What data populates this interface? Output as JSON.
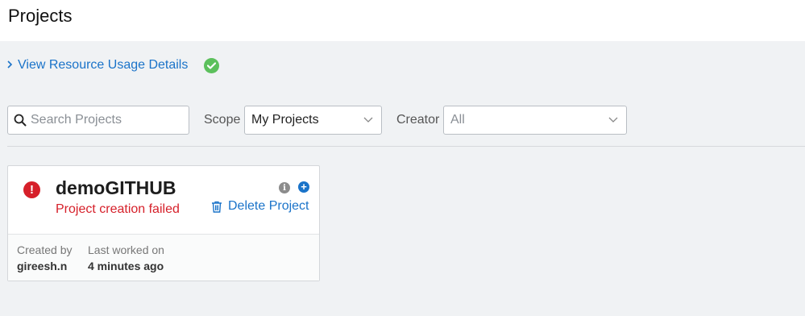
{
  "header": {
    "title": "Projects"
  },
  "resource": {
    "link_label": "View Resource Usage Details",
    "status_icon": "check-circle-icon",
    "status_color": "#5cc05c"
  },
  "filters": {
    "search_placeholder": "Search Projects",
    "search_value": "",
    "scope_label": "Scope",
    "scope_value": "My Projects",
    "creator_label": "Creator",
    "creator_value": "All"
  },
  "projects": [
    {
      "name": "demoGITHUB",
      "status": "Project creation failed",
      "status_color": "#d6202a",
      "delete_label": "Delete Project",
      "created_by_label": "Created by",
      "created_by": "gireesh.n",
      "last_worked_label": "Last worked on",
      "last_worked": "4 minutes ago"
    }
  ],
  "colors": {
    "accent": "#1a73c9",
    "error": "#d6202a",
    "success": "#5cc05c"
  }
}
